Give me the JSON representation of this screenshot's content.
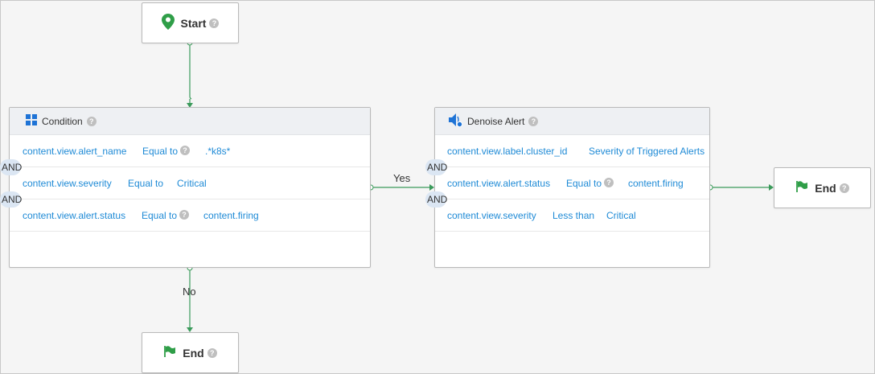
{
  "start_node": {
    "label": "Start",
    "icon": "map-pin-icon"
  },
  "end_nodes": [
    {
      "label": "End",
      "icon": "flag-icon"
    },
    {
      "label": "End",
      "icon": "flag-icon"
    }
  ],
  "help_glyph": "?",
  "condition": {
    "title": "Condition",
    "icon": "grid-icon",
    "rows": [
      {
        "field": "content.view.alert_name",
        "op": "Equal to",
        "value": ".*k8s*"
      },
      {
        "field": "content.view.severity",
        "op": "Equal to",
        "value": "Critical"
      },
      {
        "field": "content.view.alert.status",
        "op": "Equal to",
        "value": "content.firing"
      }
    ],
    "joiner": "AND"
  },
  "denoise": {
    "title": "Denoise Alert",
    "icon": "speaker-icon",
    "rows": [
      {
        "field": "content.view.label.cluster_id",
        "op": "Severity of Triggered Alerts",
        "value": ""
      },
      {
        "field": "content.view.alert.status",
        "op": "Equal to",
        "value": "content.firing"
      },
      {
        "field": "content.view.severity",
        "op": "Less than",
        "value": "Critical"
      }
    ],
    "joiner": "AND"
  },
  "edges": {
    "yes": "Yes",
    "no": "No"
  },
  "colors": {
    "wire": "#3a9a5a",
    "link": "#1e8ad6",
    "pin": "#2f9e48"
  }
}
